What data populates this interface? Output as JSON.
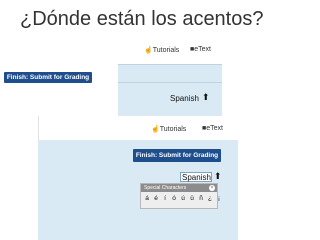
{
  "slide": {
    "title": "¿Dónde están los acentos?"
  },
  "screenshot1": {
    "tutorials_label": "Tutorials",
    "etext_label": "eText",
    "submit_button": "Finish: Submit for Grading",
    "language": "Spanish"
  },
  "screenshot2": {
    "tutorials_label": "Tutorials",
    "etext_label": "eText",
    "submit_button": "Finish: Submit for Grading",
    "language": "Spanish",
    "special_characters": {
      "title": "Special Characters",
      "chars": [
        "á",
        "é",
        "í",
        "ó",
        "ú",
        "ü",
        "ñ",
        "¿",
        "¡"
      ]
    }
  },
  "colors": {
    "button": "#1f4e8c",
    "band": "#daeaf5"
  }
}
